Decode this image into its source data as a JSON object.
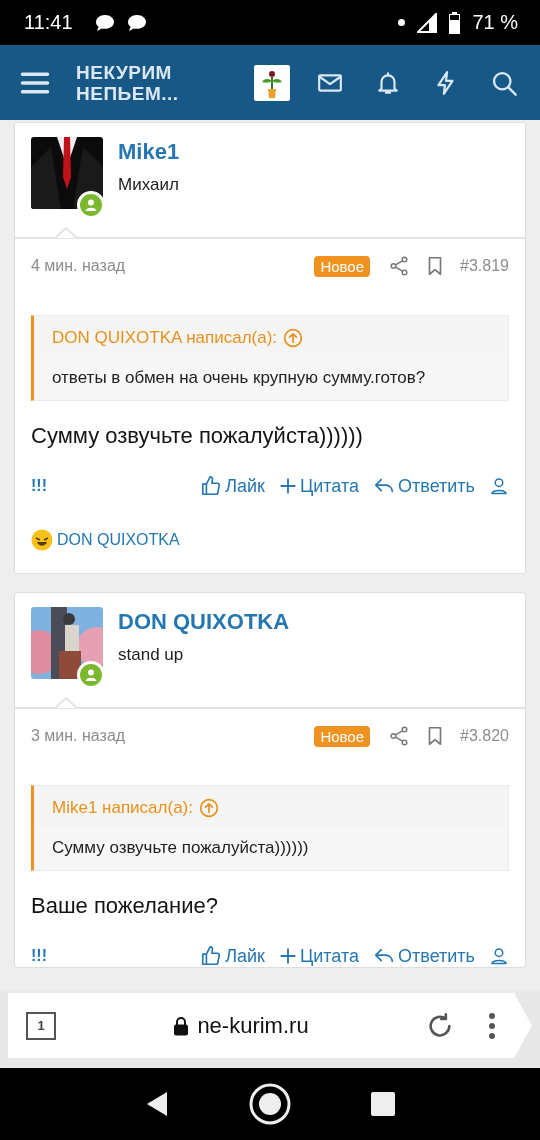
{
  "status_bar": {
    "time": "11:41",
    "battery": "71 %"
  },
  "header": {
    "site_title": "НЕКУРИМ НЕПЬЕМ..."
  },
  "posts": [
    {
      "author": "Mike1",
      "user_title": "Михаил",
      "online": true,
      "time": "4 мин. назад",
      "badge": "Новое",
      "number": "#3.819",
      "quote": {
        "source": "DON QUIXOTKA написал(а):",
        "text": "ответы в обмен на очень крупную сумму.готов?"
      },
      "body": "Сумму озвучьте пожалуйста))))))",
      "actions": {
        "flag": "!!!",
        "like": "Лайк",
        "quote": "Цитата",
        "reply": "Ответить"
      },
      "reactions": "DON QUIXOTKA"
    },
    {
      "author": "DON QUIXOTKA",
      "user_title": "stand up",
      "online": true,
      "time": "3 мин. назад",
      "badge": "Новое",
      "number": "#3.820",
      "quote": {
        "source": "Mike1 написал(а):",
        "text": "Сумму озвучьте пожалуйста))))))"
      },
      "body": "Ваше пожелание?",
      "actions": {
        "flag": "!!!",
        "like": "Лайк",
        "quote": "Цитата",
        "reply": "Ответить"
      }
    }
  ],
  "browser": {
    "tab_count": "1",
    "url": "ne-kurim.ru"
  }
}
